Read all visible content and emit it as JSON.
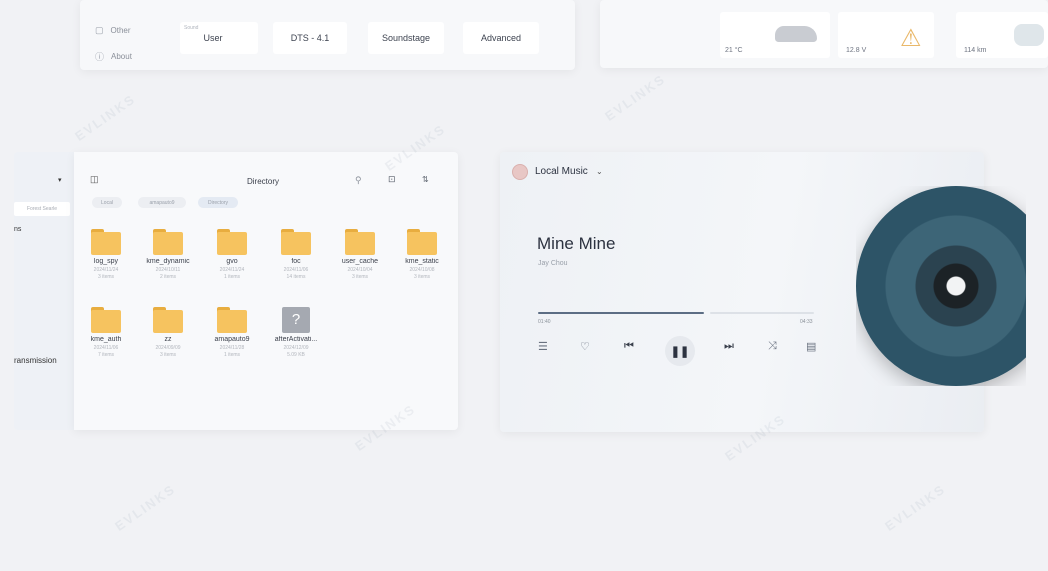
{
  "settings_panel": {
    "side_items": [
      {
        "label": "Other",
        "icon": "settings-small-icon"
      },
      {
        "label": "About",
        "icon": "info-icon"
      }
    ],
    "tabs": [
      {
        "label": "User",
        "sublabel": "Sound"
      },
      {
        "label": "DTS - 4.1"
      },
      {
        "label": "Soundstage"
      },
      {
        "label": "Advanced"
      }
    ]
  },
  "vehicle_panel": {
    "cells": [
      {
        "value": "21 °C",
        "icon": "car-icon"
      },
      {
        "value": "12.8 V",
        "icon": "voltage-warning-icon"
      },
      {
        "value": "114 km",
        "icon": "range-icon"
      }
    ]
  },
  "file_sidebar": {
    "search_hint": "Forest Searle",
    "partial_item": "ns",
    "item_transmission": "ransmission"
  },
  "file_browser": {
    "title": "Directory",
    "breadcrumbs": [
      "Local",
      "amapauto9",
      "Directory"
    ],
    "folders": [
      {
        "name": "log_spy",
        "date": "2024/11/24",
        "count": "3 items"
      },
      {
        "name": "kme_dynamic",
        "date": "2024/10/11",
        "count": "2 items"
      },
      {
        "name": "gvo",
        "date": "2024/11/24",
        "count": "1 items"
      },
      {
        "name": "foc",
        "date": "2024/11/06",
        "count": "14 items"
      },
      {
        "name": "user_cache",
        "date": "2024/10/04",
        "count": "3 items"
      },
      {
        "name": "kme_static",
        "date": "2024/10/08",
        "count": "3 items"
      },
      {
        "name": "kme_auth",
        "date": "2024/11/06",
        "count": "7 items"
      },
      {
        "name": "zz",
        "date": "2024/09/09",
        "count": "3 items"
      },
      {
        "name": "amapauto9",
        "date": "2024/11/28",
        "count": "1 items"
      },
      {
        "name": "afterActivati...",
        "date": "2024/12/09",
        "count": "5.09 KB",
        "unknown": true
      }
    ]
  },
  "music_player": {
    "source": "Local Music",
    "song_title": "Mine Mine",
    "artist": "Jay Chou",
    "elapsed": "01:40",
    "duration": "04:33",
    "progress": 0.6
  },
  "colors": {
    "folder": "#f6c35f",
    "accent": "#5c6d84"
  }
}
